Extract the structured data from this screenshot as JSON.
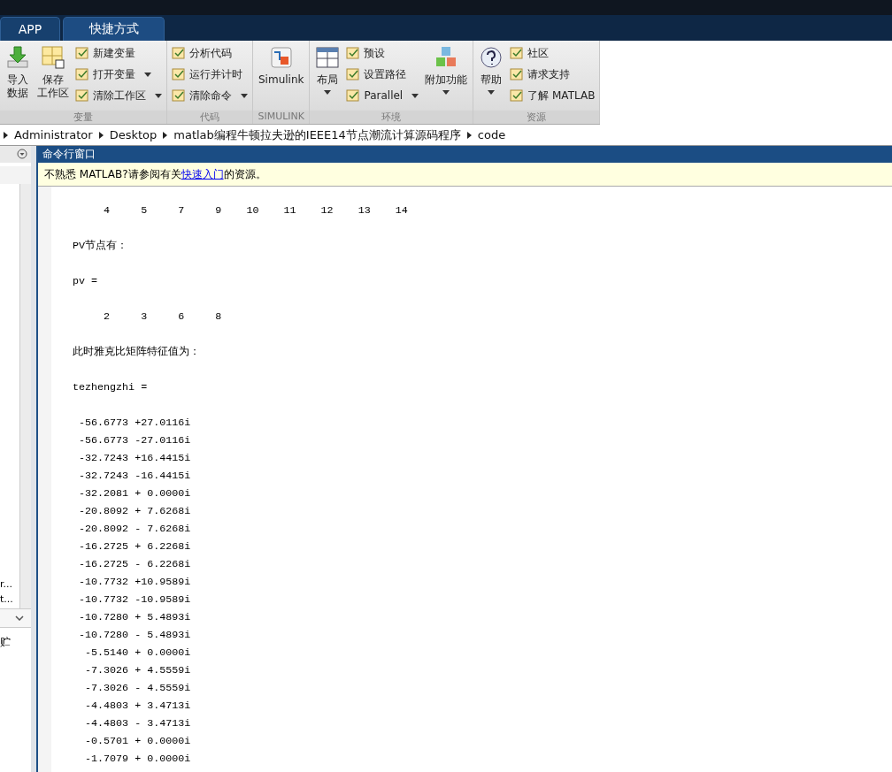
{
  "tabs": [
    {
      "label": "APP",
      "selected": false
    },
    {
      "label": "快捷方式",
      "selected": true
    }
  ],
  "ribbon": [
    {
      "title": "变量",
      "items": [
        {
          "kind": "big",
          "label": [
            "导入",
            "数据"
          ]
        },
        {
          "kind": "big",
          "label": [
            "保存",
            "工作区"
          ]
        },
        {
          "kind": "stack",
          "entries": [
            {
              "label": "新建变量",
              "menu": false
            },
            {
              "label": "打开变量",
              "menu": true
            },
            {
              "label": "清除工作区",
              "menu": true
            }
          ]
        }
      ]
    },
    {
      "title": "代码",
      "items": [
        {
          "kind": "stack",
          "entries": [
            {
              "label": "分析代码",
              "menu": false
            },
            {
              "label": "运行并计时",
              "menu": false
            },
            {
              "label": "清除命令",
              "menu": true
            }
          ]
        }
      ]
    },
    {
      "title": "SIMULINK",
      "items": [
        {
          "kind": "big",
          "label": [
            "Simulink"
          ]
        }
      ]
    },
    {
      "title": "环境",
      "items": [
        {
          "kind": "bigmenu",
          "label": [
            "布局"
          ]
        },
        {
          "kind": "stack",
          "entries": [
            {
              "label": "预设",
              "menu": false
            },
            {
              "label": "设置路径",
              "menu": false
            },
            {
              "label": "Parallel",
              "menu": true
            }
          ]
        },
        {
          "kind": "bigmenu",
          "label": [
            "附加功能"
          ]
        }
      ]
    },
    {
      "title": "资源",
      "items": [
        {
          "kind": "bigmenu",
          "label": [
            "帮助"
          ]
        },
        {
          "kind": "stack",
          "entries": [
            {
              "label": "社区",
              "menu": false
            },
            {
              "label": "请求支持",
              "menu": false
            },
            {
              "label": "了解 MATLAB",
              "menu": false
            }
          ]
        }
      ]
    }
  ],
  "path": [
    "Administrator",
    "Desktop",
    "matlab编程牛顿拉夫逊的IEEE14节点潮流计算源码程序",
    "code"
  ],
  "left_panel": {
    "items": [
      "r...",
      "t..."
    ],
    "footer": "贮"
  },
  "command_window": {
    "title": "命令行窗口",
    "notice": {
      "before": "不熟悉 MATLAB?请参阅有关",
      "link": "快速入门",
      "after": "的资源。"
    },
    "blocks": [
      [
        "     4     5     7     9    10    11    12    13    14"
      ],
      [
        "PV节点有："
      ],
      [
        "pv ="
      ],
      [
        "     2     3     6     8"
      ],
      [
        "此时雅克比矩阵特征值为："
      ],
      [
        "tezhengzhi ="
      ],
      [
        " -56.6773 +27.0116i",
        " -56.6773 -27.0116i",
        " -32.7243 +16.4415i",
        " -32.7243 -16.4415i",
        " -32.2081 + 0.0000i",
        " -20.8092 + 7.6268i",
        " -20.8092 - 7.6268i",
        " -16.2725 + 6.2268i",
        " -16.2725 - 6.2268i",
        " -10.7732 +10.9589i",
        " -10.7732 -10.9589i",
        " -10.7280 + 5.4893i",
        " -10.7280 - 5.4893i",
        "  -5.5140 + 0.0000i",
        "  -7.3026 + 4.5559i",
        "  -7.3026 - 4.5559i",
        "  -4.4803 + 3.4713i",
        "  -4.4803 - 3.4713i",
        "  -0.5701 + 0.0000i",
        "  -1.7079 + 0.0000i"
      ]
    ]
  }
}
